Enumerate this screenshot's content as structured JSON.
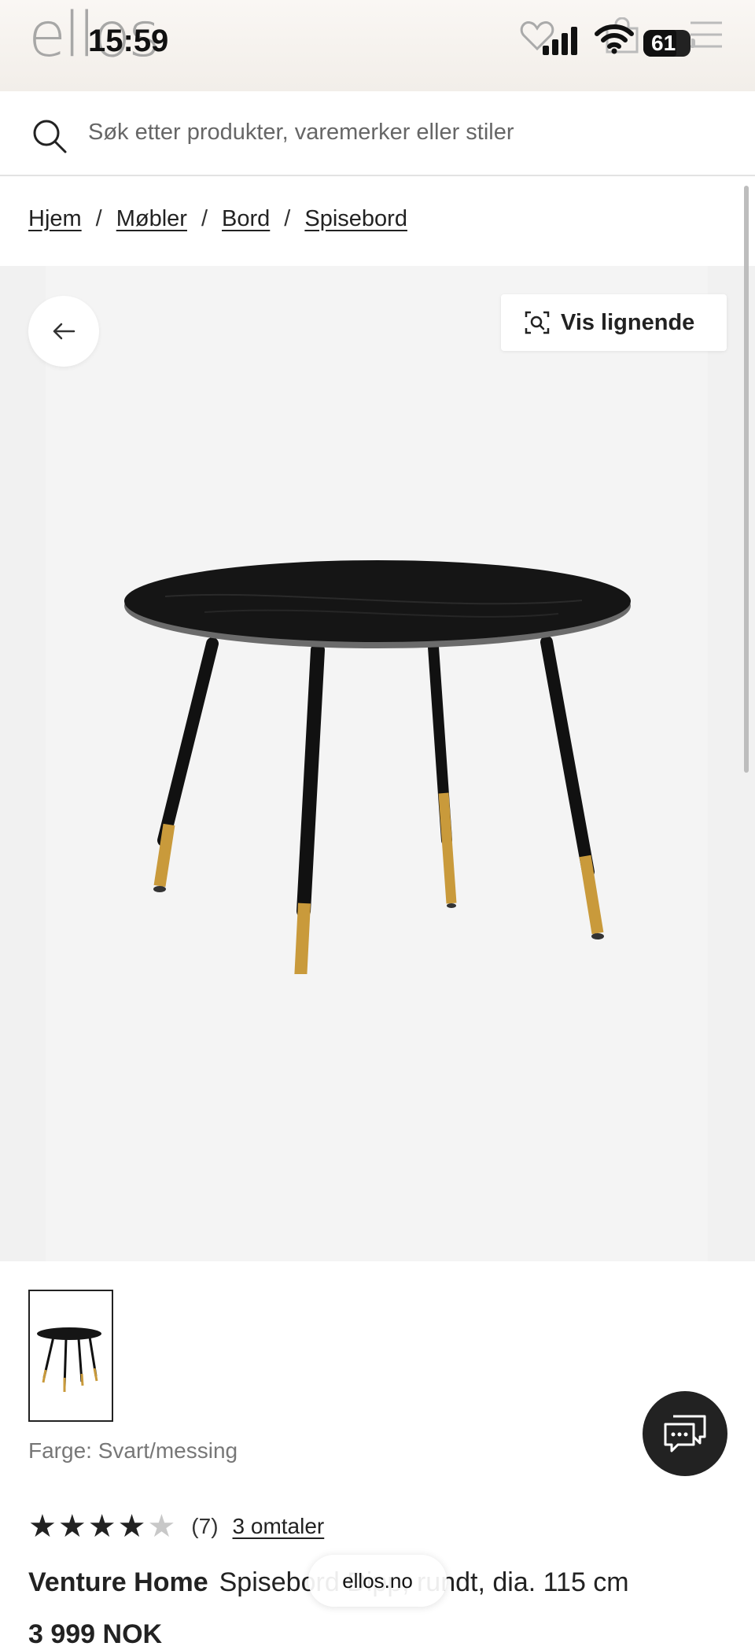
{
  "status_bar": {
    "time": "15:59",
    "battery": "61"
  },
  "header": {
    "logo": "ellos",
    "icons": [
      "heart-icon",
      "bag-icon",
      "menu-icon"
    ]
  },
  "search": {
    "placeholder": "Søk etter produkter, varemerker eller stiler"
  },
  "breadcrumb": {
    "items": [
      "Hjem",
      "Møbler",
      "Bord",
      "Spisebord"
    ],
    "separator": "/"
  },
  "gallery": {
    "similar_label": "Vis lignende"
  },
  "product": {
    "color_label": "Farge:",
    "color_value": "Svart/messing",
    "rating": 4,
    "rating_max": 5,
    "rating_count": "(7)",
    "reviews_link": "3 omtaler",
    "brand": "Venture Home",
    "name": "Spisebord Dipp, rundt, dia. 115 cm",
    "price": "3 999 NOK"
  },
  "browser": {
    "url": "ellos.no"
  },
  "colors": {
    "accent": "#222222",
    "gallery_bg": "#f1f1f1",
    "brass": "#c99a3b"
  }
}
